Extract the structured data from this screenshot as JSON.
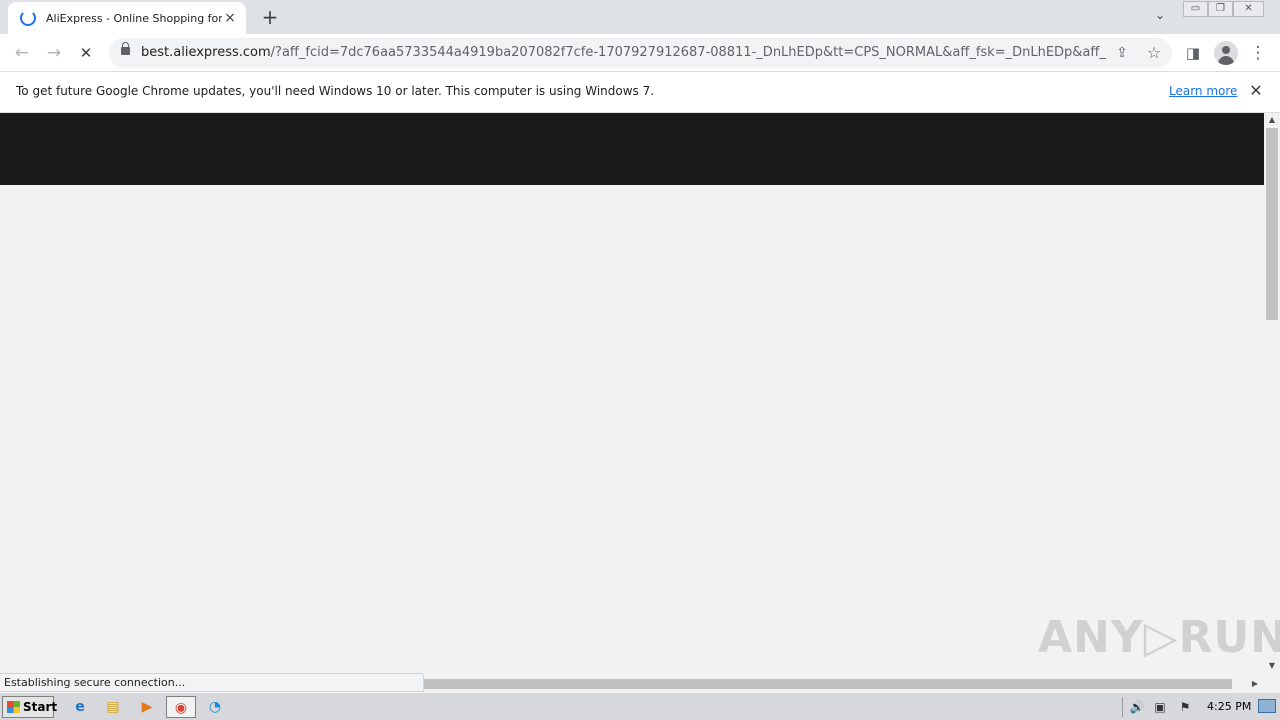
{
  "browser": {
    "tab": {
      "title": "AliExpress - Online Shopping for Popular Electronics",
      "close_icon": "×"
    },
    "new_tab_icon": "+",
    "tab_search_icon": "⌄",
    "window_controls": {
      "minimize": "▭",
      "restore": "❐",
      "close": "✕"
    },
    "toolbar": {
      "back_icon": "←",
      "forward_icon": "→",
      "reload_icon": "✕",
      "url_host": "best.aliexpress.com",
      "url_rest": "/?aff_fcid=7dc76aa5733544a4919ba207082f7cfe-1707927912687-08811-_DnLhEDp&tt=CPS_NORMAL&aff_fsk=_DnLhEDp&aff_plat...",
      "share_icon": "⇪",
      "bookmark_icon": "☆",
      "sidepanel_icon": "◨",
      "menu_icon": "⋮"
    },
    "infobar": {
      "message": "To get future Google Chrome updates, you'll need Windows 10 or later. This computer is using Windows 7.",
      "link": "Learn more",
      "close_icon": "✕"
    },
    "status": "Establishing secure connection...",
    "scroll_up": "▲",
    "scroll_down": "▼",
    "scroll_right": "▶"
  },
  "watermark": "ANY▷RUN",
  "taskbar": {
    "start_label": "Start",
    "apps": [
      {
        "name": "internet-explorer",
        "glyph": "e"
      },
      {
        "name": "file-explorer",
        "glyph": "▤"
      },
      {
        "name": "media-player",
        "glyph": "▶"
      },
      {
        "name": "chrome",
        "glyph": "◉"
      },
      {
        "name": "edge",
        "glyph": "◔"
      }
    ],
    "clock": "4:25 PM",
    "tray": {
      "volume_icon": "🔊",
      "network_icon": "▣",
      "flag_icon": "⚑"
    }
  },
  "colors": {
    "page_header": "#191919",
    "page_background": "#f2f2f2",
    "link": "#1a73e8",
    "spinner": "#1a73e8"
  }
}
